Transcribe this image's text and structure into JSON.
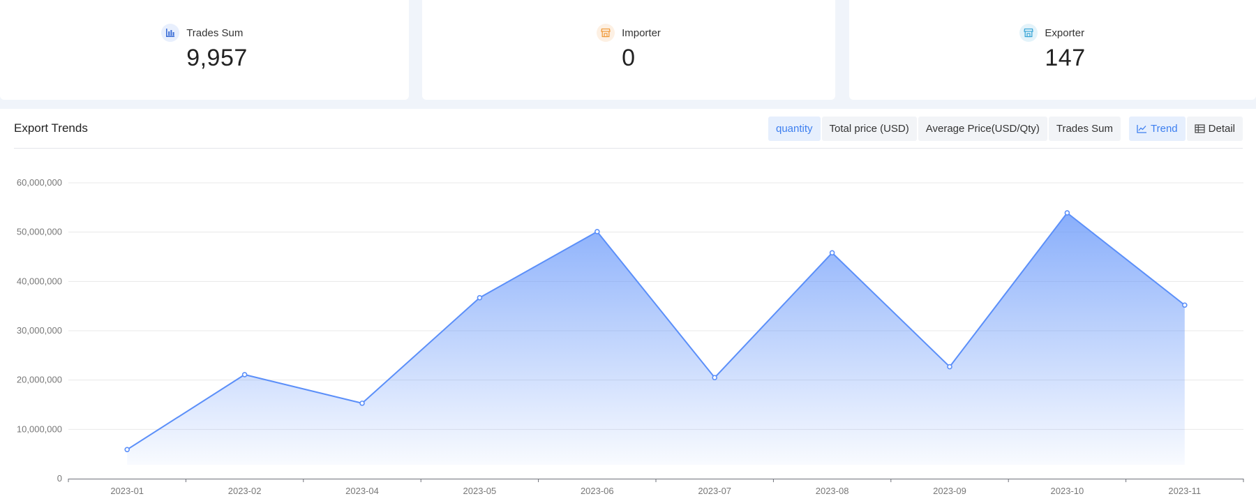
{
  "stats": [
    {
      "label": "Trades Sum",
      "value": "9,957",
      "icon": "bar-chart-icon",
      "color": "#3d6fd6"
    },
    {
      "label": "Importer",
      "value": "0",
      "icon": "store-icon",
      "color": "#f09a3a"
    },
    {
      "label": "Exporter",
      "value": "147",
      "icon": "store-icon",
      "color": "#3aa6d6"
    }
  ],
  "panel": {
    "title": "Export Trends",
    "metrics": [
      "quantity",
      "Total price (USD)",
      "Average Price(USD/Qty)",
      "Trades Sum"
    ],
    "active_metric": "quantity",
    "views": [
      "Trend",
      "Detail"
    ],
    "active_view": "Trend"
  },
  "chart_data": {
    "type": "area",
    "title": "",
    "xlabel": "",
    "ylabel": "",
    "categories": [
      "2023-01",
      "2023-02",
      "2023-04",
      "2023-05",
      "2023-06",
      "2023-07",
      "2023-08",
      "2023-09",
      "2023-10",
      "2023-11"
    ],
    "series": [
      {
        "values": [
          5900000,
          21100000,
          15300000,
          36700000,
          50100000,
          20500000,
          45800000,
          22700000,
          53900000,
          35200000
        ]
      }
    ],
    "yticks": [
      "0",
      "10,000,000",
      "20,000,000",
      "30,000,000",
      "40,000,000",
      "50,000,000",
      "60,000,000"
    ],
    "ylim": [
      0,
      60000000
    ],
    "grid": true,
    "legend": "none",
    "line_color": "#5b8ff9"
  }
}
